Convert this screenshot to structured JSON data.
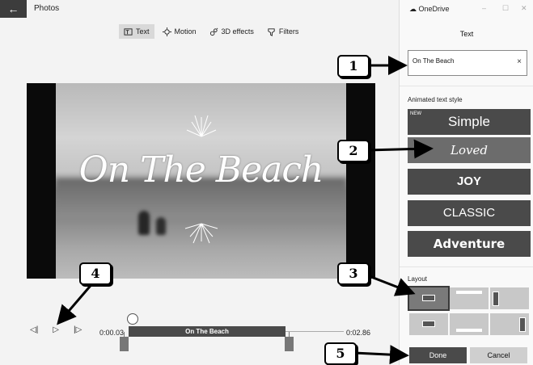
{
  "window": {
    "title": "Photos",
    "back_icon": "←"
  },
  "toolbar": {
    "tabs": [
      {
        "label": "Text",
        "icon": "text-icon",
        "active": true
      },
      {
        "label": "Motion",
        "icon": "motion-icon",
        "active": false
      },
      {
        "label": "3D effects",
        "icon": "3d-effects-icon",
        "active": false
      },
      {
        "label": "Filters",
        "icon": "filters-icon",
        "active": false
      }
    ]
  },
  "preview": {
    "overlay_text": "On The Beach"
  },
  "playback": {
    "previous_icon": "previous-frame-icon",
    "play_icon": "play-icon",
    "next_icon": "next-frame-icon",
    "current_time": "0:00.03",
    "end_time": "0:02.86",
    "clip_label": "On The Beach"
  },
  "panel": {
    "header_label": "OneDrive",
    "window_controls": {
      "minimize": "–",
      "maximize": "☐",
      "close": "✕"
    },
    "title": "Text",
    "text_value": "On The Beach",
    "clear_icon": "×",
    "animated_style_label": "Animated text style",
    "styles": [
      {
        "label": "Simple",
        "badge": "NEW"
      },
      {
        "label": "Loved"
      },
      {
        "label": "JOY"
      },
      {
        "label": "CLASSIC"
      },
      {
        "label": "Adventure"
      }
    ],
    "selected_style": "Loved",
    "layout_label": "Layout",
    "layout_count": 6,
    "selected_layout": 1,
    "done_label": "Done",
    "cancel_label": "Cancel"
  },
  "callouts": [
    "1",
    "2",
    "3",
    "4",
    "5"
  ],
  "colors": {
    "accent_dark": "#4a4a4a",
    "background": "#f3f3f3",
    "panel": "#f9f9f9"
  }
}
